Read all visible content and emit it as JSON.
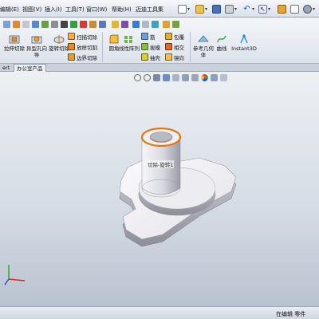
{
  "menu": {
    "items": [
      {
        "label": "编辑(E)"
      },
      {
        "label": "视图(V)"
      },
      {
        "label": "插入(I)"
      },
      {
        "label": "工具(T)"
      },
      {
        "label": "窗口(W)"
      },
      {
        "label": "帮助(H)"
      },
      {
        "label": "迈迪工具集"
      }
    ]
  },
  "toolbar": {
    "extrude_cut": "拉伸切除",
    "hole_wizard": "异型孔向导",
    "revolve_cut": "旋转切除",
    "sweep_cut": "扫描切除",
    "loft_cut": "放样切割",
    "boundary_cut": "边界切除",
    "fillet": "圆角",
    "linear_pattern": "线性阵列",
    "rib": "筋",
    "draft": "拔模",
    "dome": "包覆",
    "intersect": "相交",
    "shell": "抽壳",
    "mirror": "镜向",
    "ref_geometry": "参考几何体",
    "curves": "曲线",
    "instant3d": "Instant3D"
  },
  "tabs": {
    "left": "ert",
    "office": "办公室产品"
  },
  "viewport": {
    "feature_label": "切除-旋转1"
  },
  "status": {
    "text": "在编辑 零件"
  },
  "colors": {
    "accent_orange": "#e07a10",
    "part_light": "#f4f4f7",
    "part_shadow": "#8d8d99"
  }
}
